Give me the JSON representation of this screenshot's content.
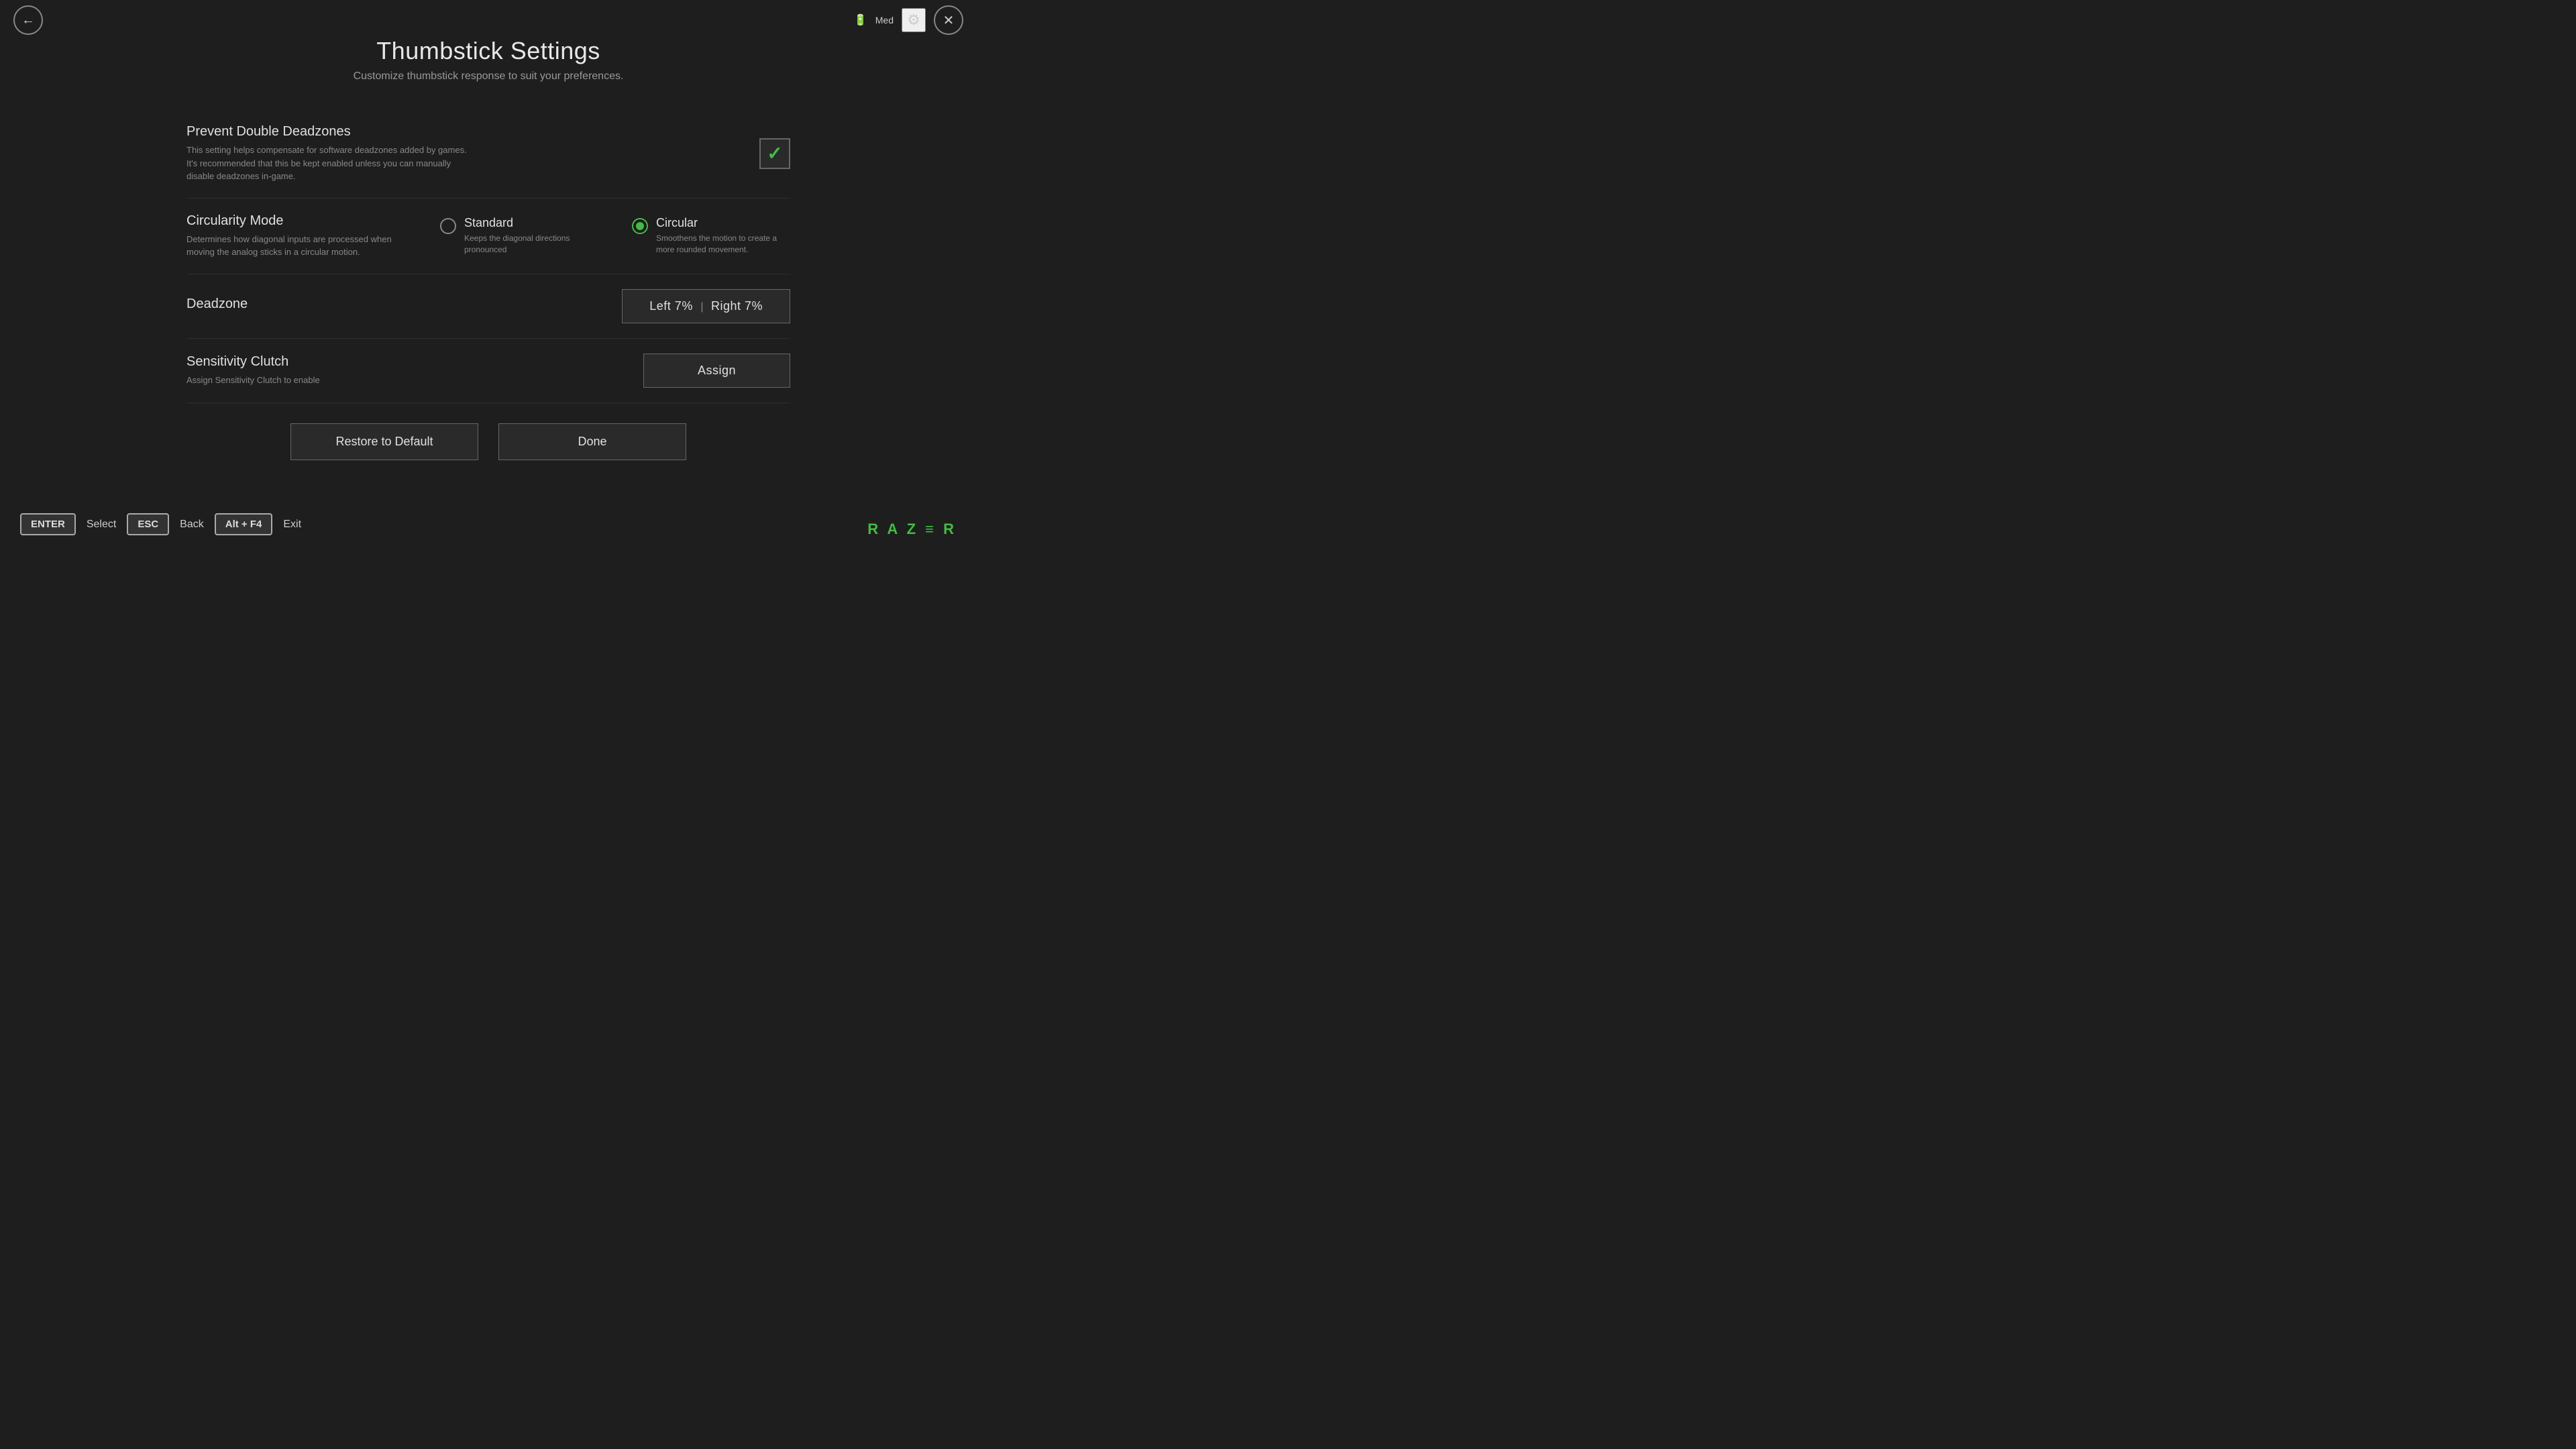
{
  "header": {
    "title": "Thumbstick Settings",
    "subtitle": "Customize thumbstick response to suit your preferences."
  },
  "topBar": {
    "batteryLabel": "Med",
    "backArrow": "←",
    "closeX": "✕",
    "gearIcon": "⚙"
  },
  "settings": {
    "preventDoubleDeadzones": {
      "label": "Prevent Double Deadzones",
      "description": "This setting helps compensate for software deadzones added by games. It's recommended that this be kept enabled unless you can manually disable deadzones in-game.",
      "checked": true,
      "checkmark": "✓"
    },
    "circularityMode": {
      "label": "Circularity Mode",
      "description": "Determines how diagonal inputs are processed when moving the analog sticks in a circular motion.",
      "options": [
        {
          "id": "standard",
          "label": "Standard",
          "description": "Keeps the diagonal directions pronounced",
          "selected": false
        },
        {
          "id": "circular",
          "label": "Circular",
          "description": "Smoothens the motion to create a more rounded movement.",
          "selected": true
        }
      ]
    },
    "deadzone": {
      "label": "Deadzone",
      "leftLabel": "Left 7%",
      "rightLabel": "Right 7%",
      "divider": "|"
    },
    "sensitivityClutch": {
      "label": "Sensitivity Clutch",
      "description": "Assign Sensitivity Clutch to enable",
      "assignLabel": "Assign"
    }
  },
  "buttons": {
    "restoreLabel": "Restore to Default",
    "doneLabel": "Done"
  },
  "shortcuts": [
    {
      "key": "ENTER",
      "label": "Select"
    },
    {
      "key": "ESC",
      "label": "Back"
    },
    {
      "key": "Alt + F4",
      "label": "Exit"
    }
  ],
  "razerLogo": "R A Z ≡ R"
}
